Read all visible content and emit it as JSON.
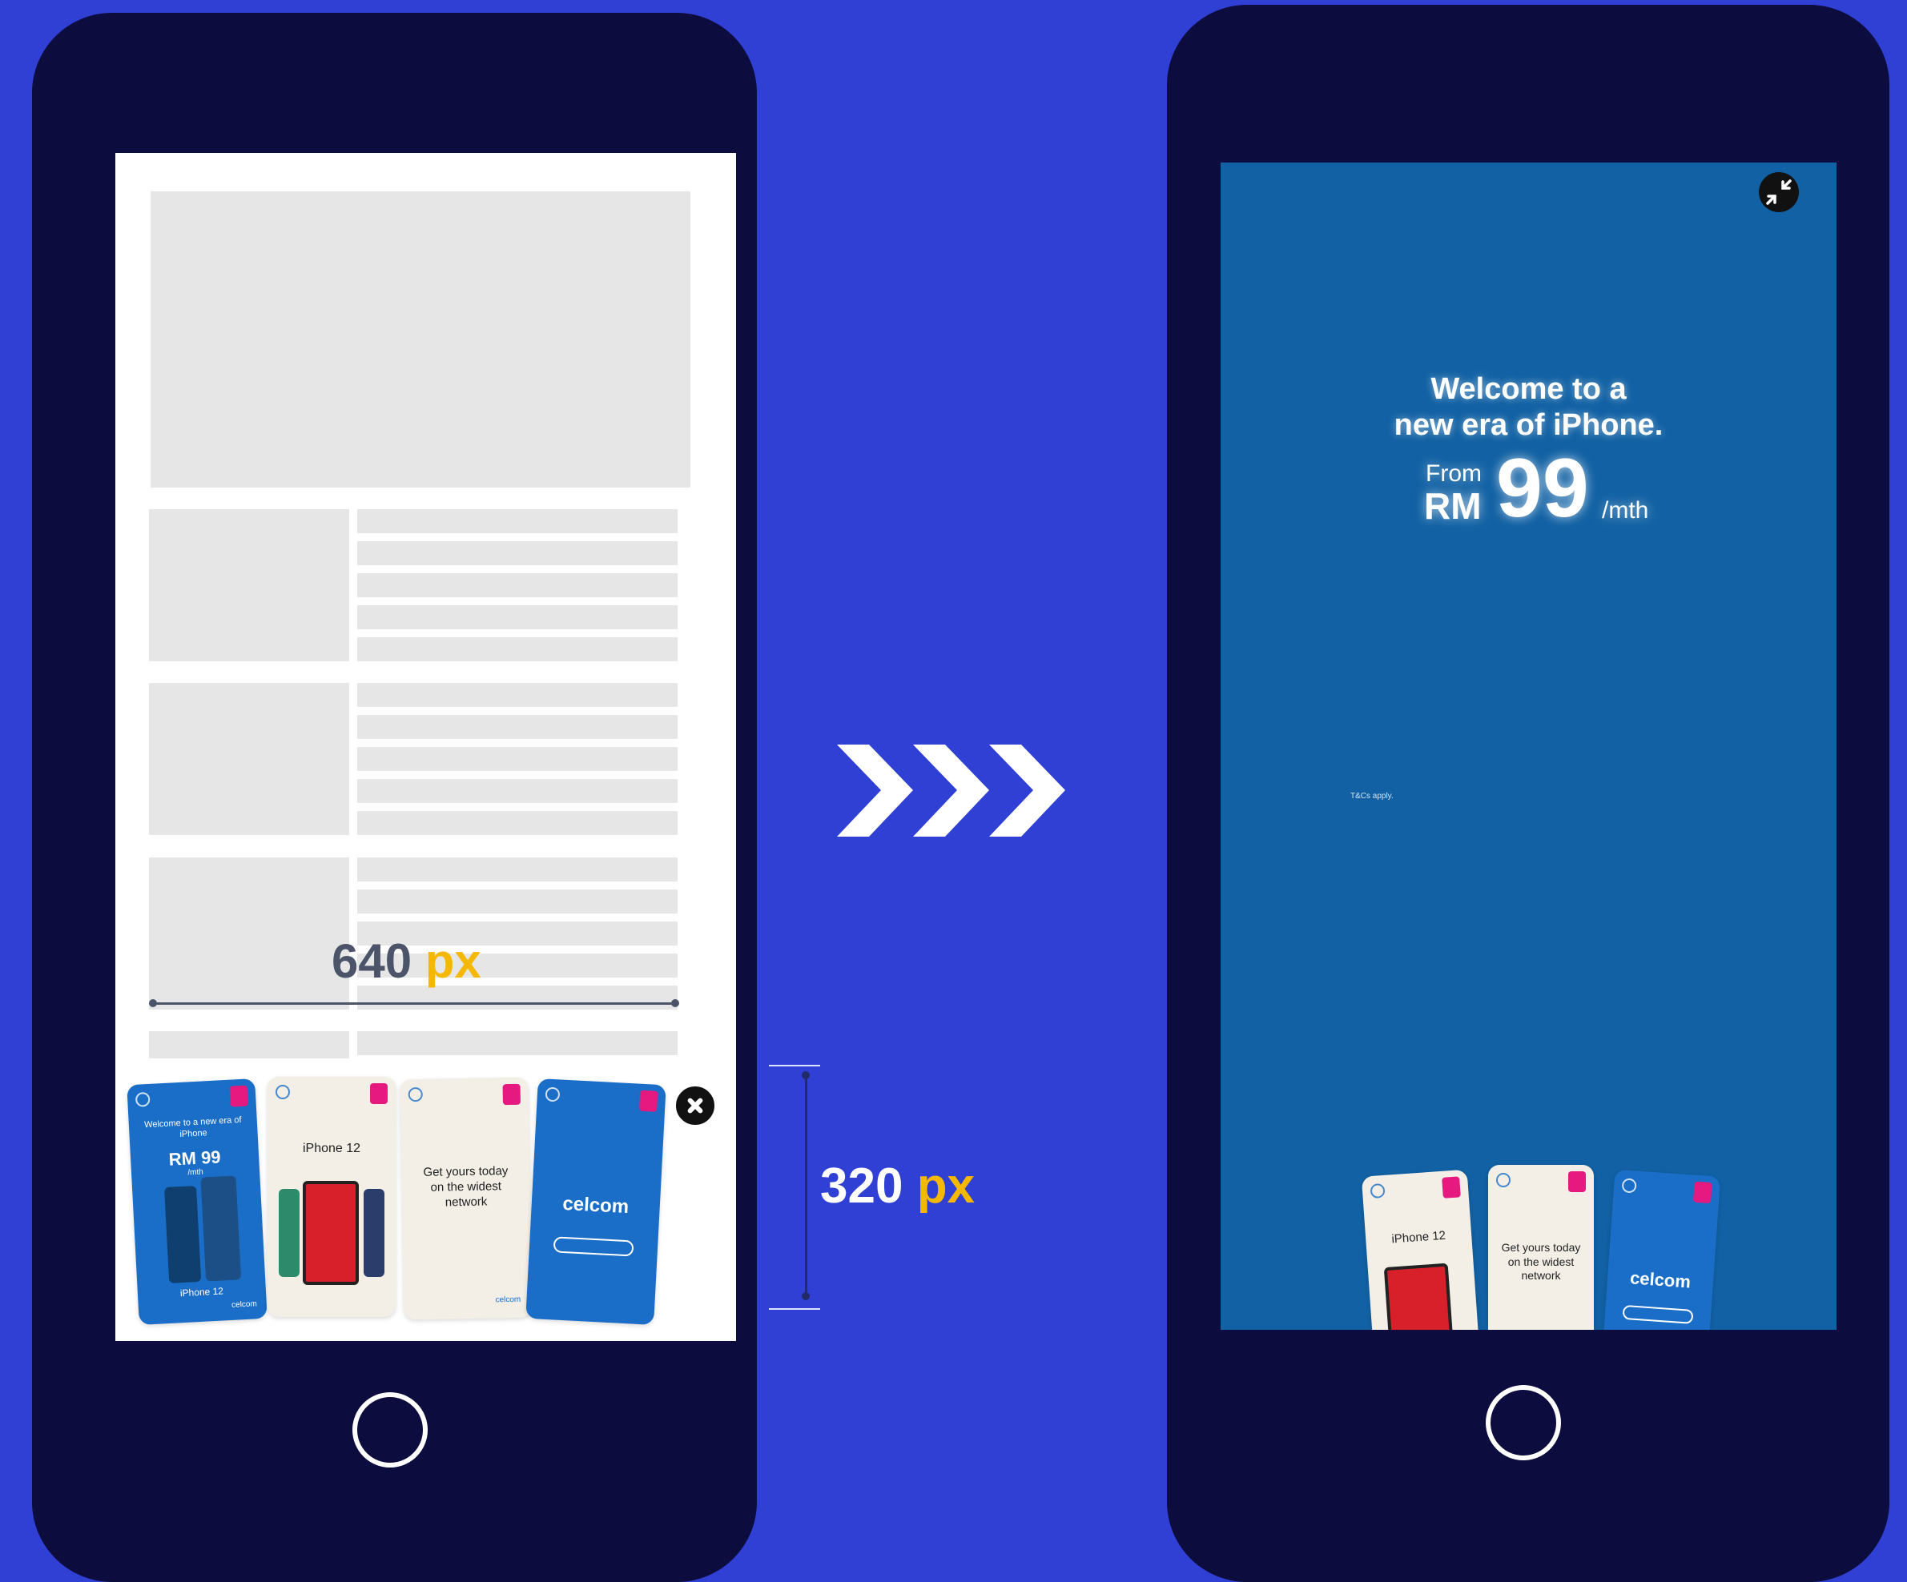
{
  "measurements": {
    "width": {
      "number": "640",
      "unit": "px"
    },
    "height": {
      "number": "320",
      "unit": "px"
    }
  },
  "banner_cards": [
    {
      "headline": "Welcome to a new era of iPhone",
      "price": "RM 99",
      "price_unit": "/mth",
      "product": "iPhone 12",
      "brand": "celcom"
    },
    {
      "product": "iPhone 12"
    },
    {
      "headline": "Get yours today on the widest network",
      "brand": "celcom"
    },
    {
      "brand": "celcom"
    }
  ],
  "ad_fullscreen": {
    "headline_line1": "Welcome to a",
    "headline_line2": "new era of iPhone.",
    "price_prefix": "From",
    "currency": "RM",
    "price": "99",
    "price_unit": "/mth",
    "terms": "T&Cs apply.",
    "cards": [
      {
        "product": "iPhone 12"
      },
      {
        "headline": "Get yours today on the widest network"
      },
      {
        "brand": "celcom"
      }
    ]
  },
  "icons": {
    "close": "close-icon",
    "collapse": "collapse-icon",
    "arrow": "chevron-right-icon",
    "home": "home-button-icon"
  },
  "colors": {
    "background": "#3040d4",
    "phone_body": "#0c0c3e",
    "ad_blue": "#1161a4",
    "accent_unit": "#f5b800",
    "celcom_blue": "#1a6ec8"
  }
}
